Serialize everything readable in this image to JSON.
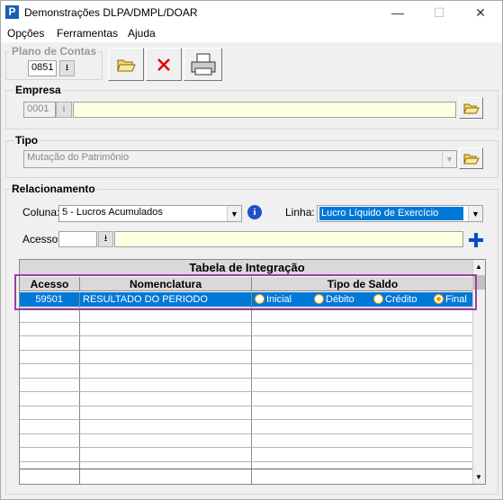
{
  "window": {
    "title": "Demonstrações DLPA/DMPL/DOAR",
    "icon_letter": "P"
  },
  "menu": [
    "Opções",
    "Ferramentas",
    "Ajuda"
  ],
  "plano": {
    "label": "Plano de Contas",
    "value": "0851"
  },
  "empresa": {
    "label": "Empresa",
    "code": "0001",
    "name": ""
  },
  "tipo": {
    "label": "Tipo",
    "value": "Mutação do Patrimônio"
  },
  "relacionamento": {
    "label": "Relacionamento",
    "coluna_label": "Coluna:",
    "coluna_value": "5 - Lucros Acumulados",
    "linha_label": "Linha:",
    "linha_value": "Lucro Líquido de Exercício",
    "acesso_label": "Acesso:",
    "acesso_value": "",
    "acesso_desc": ""
  },
  "table": {
    "title": "Tabela de Integração",
    "headers": [
      "Acesso",
      "Nomenclatura",
      "Tipo de Saldo"
    ],
    "rows": [
      {
        "acesso": "59501",
        "nome": "RESULTADO DO PERIODO",
        "selected": "Final"
      }
    ],
    "radio_options": [
      "Inicial",
      "Débito",
      "Crédito",
      "Final"
    ]
  },
  "colors": {
    "selection": "#0078d7",
    "highlight_box": "#9c3fa3",
    "radio": "#e8a000",
    "add_icon": "#0050c8",
    "delete_icon": "#e00000"
  }
}
